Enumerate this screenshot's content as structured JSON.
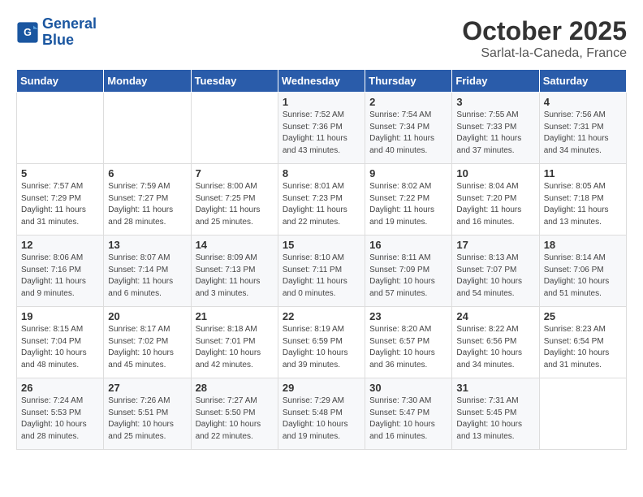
{
  "header": {
    "logo_general": "General",
    "logo_blue": "Blue",
    "month": "October 2025",
    "location": "Sarlat-la-Caneda, France"
  },
  "days_of_week": [
    "Sunday",
    "Monday",
    "Tuesday",
    "Wednesday",
    "Thursday",
    "Friday",
    "Saturday"
  ],
  "weeks": [
    [
      {
        "day": "",
        "info": ""
      },
      {
        "day": "",
        "info": ""
      },
      {
        "day": "",
        "info": ""
      },
      {
        "day": "1",
        "info": "Sunrise: 7:52 AM\nSunset: 7:36 PM\nDaylight: 11 hours\nand 43 minutes."
      },
      {
        "day": "2",
        "info": "Sunrise: 7:54 AM\nSunset: 7:34 PM\nDaylight: 11 hours\nand 40 minutes."
      },
      {
        "day": "3",
        "info": "Sunrise: 7:55 AM\nSunset: 7:33 PM\nDaylight: 11 hours\nand 37 minutes."
      },
      {
        "day": "4",
        "info": "Sunrise: 7:56 AM\nSunset: 7:31 PM\nDaylight: 11 hours\nand 34 minutes."
      }
    ],
    [
      {
        "day": "5",
        "info": "Sunrise: 7:57 AM\nSunset: 7:29 PM\nDaylight: 11 hours\nand 31 minutes."
      },
      {
        "day": "6",
        "info": "Sunrise: 7:59 AM\nSunset: 7:27 PM\nDaylight: 11 hours\nand 28 minutes."
      },
      {
        "day": "7",
        "info": "Sunrise: 8:00 AM\nSunset: 7:25 PM\nDaylight: 11 hours\nand 25 minutes."
      },
      {
        "day": "8",
        "info": "Sunrise: 8:01 AM\nSunset: 7:23 PM\nDaylight: 11 hours\nand 22 minutes."
      },
      {
        "day": "9",
        "info": "Sunrise: 8:02 AM\nSunset: 7:22 PM\nDaylight: 11 hours\nand 19 minutes."
      },
      {
        "day": "10",
        "info": "Sunrise: 8:04 AM\nSunset: 7:20 PM\nDaylight: 11 hours\nand 16 minutes."
      },
      {
        "day": "11",
        "info": "Sunrise: 8:05 AM\nSunset: 7:18 PM\nDaylight: 11 hours\nand 13 minutes."
      }
    ],
    [
      {
        "day": "12",
        "info": "Sunrise: 8:06 AM\nSunset: 7:16 PM\nDaylight: 11 hours\nand 9 minutes."
      },
      {
        "day": "13",
        "info": "Sunrise: 8:07 AM\nSunset: 7:14 PM\nDaylight: 11 hours\nand 6 minutes."
      },
      {
        "day": "14",
        "info": "Sunrise: 8:09 AM\nSunset: 7:13 PM\nDaylight: 11 hours\nand 3 minutes."
      },
      {
        "day": "15",
        "info": "Sunrise: 8:10 AM\nSunset: 7:11 PM\nDaylight: 11 hours\nand 0 minutes."
      },
      {
        "day": "16",
        "info": "Sunrise: 8:11 AM\nSunset: 7:09 PM\nDaylight: 10 hours\nand 57 minutes."
      },
      {
        "day": "17",
        "info": "Sunrise: 8:13 AM\nSunset: 7:07 PM\nDaylight: 10 hours\nand 54 minutes."
      },
      {
        "day": "18",
        "info": "Sunrise: 8:14 AM\nSunset: 7:06 PM\nDaylight: 10 hours\nand 51 minutes."
      }
    ],
    [
      {
        "day": "19",
        "info": "Sunrise: 8:15 AM\nSunset: 7:04 PM\nDaylight: 10 hours\nand 48 minutes."
      },
      {
        "day": "20",
        "info": "Sunrise: 8:17 AM\nSunset: 7:02 PM\nDaylight: 10 hours\nand 45 minutes."
      },
      {
        "day": "21",
        "info": "Sunrise: 8:18 AM\nSunset: 7:01 PM\nDaylight: 10 hours\nand 42 minutes."
      },
      {
        "day": "22",
        "info": "Sunrise: 8:19 AM\nSunset: 6:59 PM\nDaylight: 10 hours\nand 39 minutes."
      },
      {
        "day": "23",
        "info": "Sunrise: 8:20 AM\nSunset: 6:57 PM\nDaylight: 10 hours\nand 36 minutes."
      },
      {
        "day": "24",
        "info": "Sunrise: 8:22 AM\nSunset: 6:56 PM\nDaylight: 10 hours\nand 34 minutes."
      },
      {
        "day": "25",
        "info": "Sunrise: 8:23 AM\nSunset: 6:54 PM\nDaylight: 10 hours\nand 31 minutes."
      }
    ],
    [
      {
        "day": "26",
        "info": "Sunrise: 7:24 AM\nSunset: 5:53 PM\nDaylight: 10 hours\nand 28 minutes."
      },
      {
        "day": "27",
        "info": "Sunrise: 7:26 AM\nSunset: 5:51 PM\nDaylight: 10 hours\nand 25 minutes."
      },
      {
        "day": "28",
        "info": "Sunrise: 7:27 AM\nSunset: 5:50 PM\nDaylight: 10 hours\nand 22 minutes."
      },
      {
        "day": "29",
        "info": "Sunrise: 7:29 AM\nSunset: 5:48 PM\nDaylight: 10 hours\nand 19 minutes."
      },
      {
        "day": "30",
        "info": "Sunrise: 7:30 AM\nSunset: 5:47 PM\nDaylight: 10 hours\nand 16 minutes."
      },
      {
        "day": "31",
        "info": "Sunrise: 7:31 AM\nSunset: 5:45 PM\nDaylight: 10 hours\nand 13 minutes."
      },
      {
        "day": "",
        "info": ""
      }
    ]
  ]
}
